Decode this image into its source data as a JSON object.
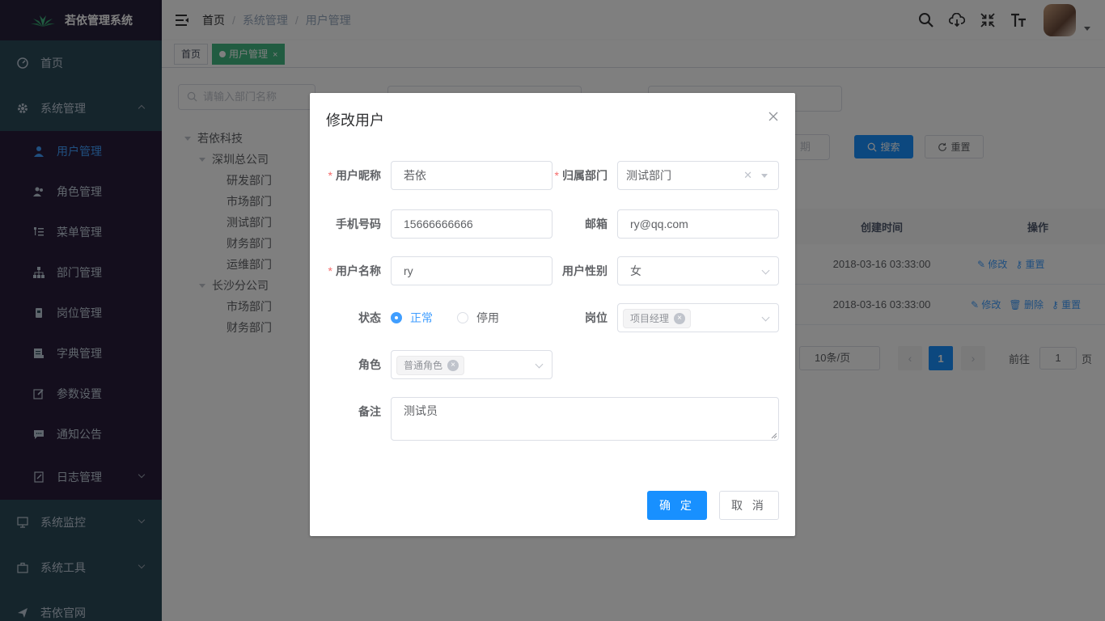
{
  "app": {
    "title": "若依管理系统"
  },
  "sidebar": {
    "items": [
      {
        "label": "首页",
        "icon": "dashboard-icon"
      },
      {
        "label": "系统管理",
        "icon": "gear-icon",
        "expanded": true
      },
      {
        "label": "系统监控",
        "icon": "monitor-icon"
      },
      {
        "label": "系统工具",
        "icon": "toolbox-icon"
      },
      {
        "label": "若依官网",
        "icon": "send-icon"
      }
    ],
    "sub_items": [
      {
        "label": "用户管理",
        "icon": "user-icon",
        "active": true
      },
      {
        "label": "角色管理",
        "icon": "peoples-icon"
      },
      {
        "label": "菜单管理",
        "icon": "tree-table-icon"
      },
      {
        "label": "部门管理",
        "icon": "tree-icon"
      },
      {
        "label": "岗位管理",
        "icon": "post-icon"
      },
      {
        "label": "字典管理",
        "icon": "dict-icon"
      },
      {
        "label": "参数设置",
        "icon": "edit-icon"
      },
      {
        "label": "通知公告",
        "icon": "message-icon"
      },
      {
        "label": "日志管理",
        "icon": "log-icon"
      }
    ]
  },
  "breadcrumb": [
    "首页",
    "系统管理",
    "用户管理"
  ],
  "tags": [
    {
      "label": "首页",
      "active": false
    },
    {
      "label": "用户管理",
      "active": true,
      "close": "×"
    }
  ],
  "dept_tree": {
    "search_placeholder": "请输入部门名称",
    "nodes": [
      {
        "label": "若依科技",
        "level": 0,
        "expandable": true
      },
      {
        "label": "深圳总公司",
        "level": 1,
        "expandable": true
      },
      {
        "label": "研发部门",
        "level": 2
      },
      {
        "label": "市场部门",
        "level": 2
      },
      {
        "label": "测试部门",
        "level": 2
      },
      {
        "label": "财务部门",
        "level": 2
      },
      {
        "label": "运维部门",
        "level": 2
      },
      {
        "label": "长沙分公司",
        "level": 1,
        "expandable": true
      },
      {
        "label": "市场部门",
        "level": 2
      },
      {
        "label": "财务部门",
        "level": 2
      }
    ]
  },
  "query": {
    "date_tail": "期",
    "search_label": "搜索",
    "reset_label": "重置"
  },
  "table": {
    "headers": [
      "创建时间",
      "操作"
    ],
    "rows": [
      {
        "time": "2018-03-16 03:33:00",
        "ops": [
          "修改",
          "重置"
        ]
      },
      {
        "time": "2018-03-16 03:33:00",
        "ops": [
          "修改",
          "删除",
          "重置"
        ]
      }
    ]
  },
  "pagination": {
    "page_size": "10条/页",
    "current": "1",
    "goto_label": "前往",
    "goto_value": "1",
    "page_unit": "页"
  },
  "dialog": {
    "title": "修改用户",
    "fields": {
      "nick_name": {
        "label": "用户昵称",
        "value": "若依",
        "required": true
      },
      "dept": {
        "label": "归属部门",
        "value": "测试部门",
        "required": true
      },
      "phone": {
        "label": "手机号码",
        "value": "15666666666"
      },
      "email": {
        "label": "邮箱",
        "value": "ry@qq.com"
      },
      "user_name": {
        "label": "用户名称",
        "value": "ry",
        "required": true
      },
      "sex": {
        "label": "用户性别",
        "value": "女"
      },
      "status": {
        "label": "状态",
        "options": [
          "正常",
          "停用"
        ],
        "selected": "正常"
      },
      "post": {
        "label": "岗位",
        "tags": [
          "项目经理"
        ]
      },
      "role": {
        "label": "角色",
        "tags": [
          "普通角色"
        ]
      },
      "remark": {
        "label": "备注",
        "value": "测试员"
      }
    },
    "ok_label": "确 定",
    "cancel_label": "取 消"
  },
  "colors": {
    "primary": "#1890ff",
    "sidebar_bg": "#2b4a59",
    "tag_active": "#42b983",
    "required": "#f56c6c"
  }
}
